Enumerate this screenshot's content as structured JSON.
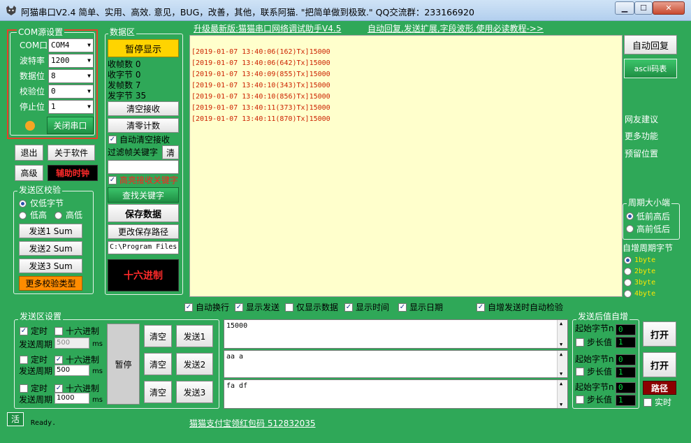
{
  "window": {
    "title": "阿猫串口V2.4  简单、实用、高效. 意见，BUG，改善，其他，联系阿猫. \"把简单做到极致.\" QQ交流群：233166920"
  },
  "links": {
    "upgrade": "升级最新版:猫猫串口网络调试助手V4.5",
    "auto_reply_info": "自动回复,发送扩展,字段波形,使用必读教程->>",
    "alipay": "猫猫支付宝领红包码 512832035"
  },
  "com": {
    "group_title": "COM源设置",
    "port_label": "COM口",
    "port_value": "COM4",
    "baud_label": "波特率",
    "baud_value": "1200",
    "data_label": "数据位",
    "data_value": "8",
    "parity_label": "校验位",
    "parity_value": "0",
    "stop_label": "停止位",
    "stop_value": "1",
    "close_button": "关闭串口",
    "status_color": "#f5a623"
  },
  "left_buttons": {
    "exit": "退出",
    "about": "关于软件",
    "advanced": "高级",
    "aux_clock": "辅助时钟"
  },
  "send_check": {
    "group_title": "发送区校验",
    "low_byte": "仅低字节",
    "low_high": "低高",
    "high_low": "高低",
    "send1": "发送1 Sum",
    "send2": "发送2 Sum",
    "send3": "发送3 Sum",
    "more": "更多校验类型"
  },
  "data_area": {
    "group_title": "数据区",
    "pause_display": "暂停显示",
    "rx_frames_label": "收帧数",
    "rx_frames": "0",
    "rx_bytes_label": "收字节",
    "rx_bytes": "0",
    "tx_frames_label": "发帧数",
    "tx_frames": "7",
    "tx_bytes_label": "发字节",
    "tx_bytes": "35",
    "clear_recv": "清空接收",
    "reset_count": "清零计数",
    "auto_clear": "自动清空接收",
    "filter_label": "过滤帧关键字",
    "filter_clear": "清",
    "highlight": "高亮接收关键字",
    "find_keyword": "查找关键字",
    "save_data": "保存数据",
    "change_path": "更改保存路径",
    "path_value": "C:\\Program Files",
    "hex_mode": "十六进制"
  },
  "recv_lines": [
    "[2019-01-07 13:40:06(162)Tx]15000",
    "[2019-01-07 13:40:06(642)Tx]15000",
    "[2019-01-07 13:40:09(855)Tx]15000",
    "[2019-01-07 13:40:10(343)Tx]15000",
    "[2019-01-07 13:40:10(856)Tx]15000",
    "[2019-01-07 13:40:11(373)Tx]15000",
    "[2019-01-07 13:40:11(870)Tx]15000"
  ],
  "right_panel": {
    "auto_reply": "自动回复",
    "ascii_table": "ascii码表",
    "suggest": "网友建议",
    "more_func": "更多功能",
    "reserved": "预留位置",
    "endian_title": "周期大小端",
    "low_first": "低前高后",
    "high_first": "高前低后",
    "auto_inc_title": "自增周期字节",
    "byte1": "1byte",
    "byte2": "2byte",
    "byte3": "3byte",
    "byte4": "4byte"
  },
  "options_row": {
    "auto_wrap": "自动换行",
    "show_send": "显示发送",
    "only_data": "仅显示数据",
    "show_time": "显示时间",
    "show_date": "显示日期",
    "auto_check": "自增发送时自动检验"
  },
  "send_area": {
    "group_title": "发送区设置",
    "timed": "定时",
    "hex": "十六进制",
    "period": "发送周期",
    "ms": "ms",
    "period1": "500",
    "period2": "500",
    "period3": "1000",
    "pause": "暂停",
    "clear": "清空",
    "send1": "发送1",
    "send2": "发送2",
    "send3": "发送3",
    "text1": "15000",
    "text2": "aa a",
    "text3": "fa df"
  },
  "post_send": {
    "group_title": "发送后值自增",
    "start_byte": "起始字节n",
    "step": "步长值",
    "start1": "0",
    "step1": "1",
    "start2": "0",
    "step2": "1",
    "start3": "0",
    "step3": "1",
    "open1": "打开",
    "open2": "打开",
    "path": "路径",
    "realtime": "实时"
  },
  "status": {
    "live": "活",
    "text": "Ready."
  }
}
